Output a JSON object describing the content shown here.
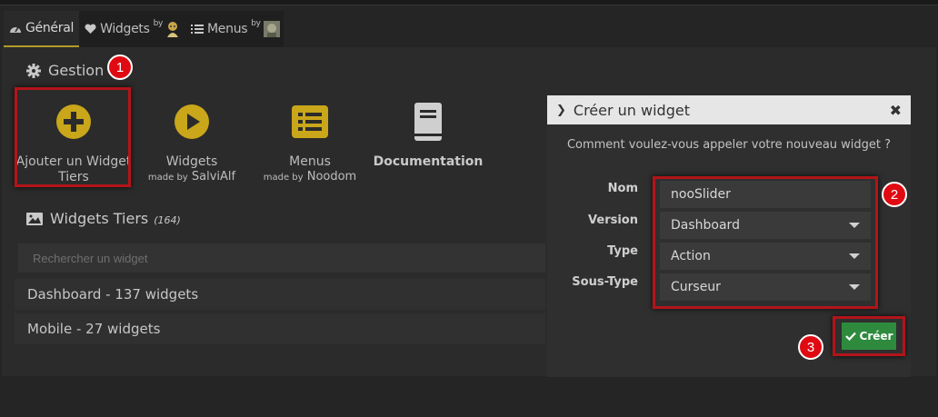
{
  "tabs": [
    {
      "label": "Général",
      "icon": "dashboard-icon",
      "active": true
    },
    {
      "label": "Widgets",
      "icon": "heart-icon",
      "sup": "by"
    },
    {
      "label": "Menus",
      "icon": "list-icon",
      "sup": "by"
    }
  ],
  "gestion": {
    "title": "Gestion",
    "cards": [
      {
        "label_line1": "Ajouter un Widget",
        "label_line2": "Tiers",
        "icon": "plus-circle-icon"
      },
      {
        "label": "Widgets",
        "sub_prefix": "made by",
        "sub_name": "SalviAlf",
        "icon": "play-circle-icon"
      },
      {
        "label": "Menus",
        "sub_prefix": "made by",
        "sub_name": "Noodom",
        "icon": "list-icon"
      },
      {
        "label": "Documentation",
        "icon": "book-icon"
      }
    ]
  },
  "widgets_tiers": {
    "title": "Widgets Tiers",
    "count": "(164)",
    "search_placeholder": "Rechercher un widget",
    "groups": [
      "Dashboard - 137 widgets",
      "Mobile - 27 widgets"
    ]
  },
  "modal": {
    "title": "Créer un widget",
    "question": "Comment voulez-vous appeler votre nouveau widget ?",
    "fields": [
      {
        "label": "Nom",
        "value": "nooSlider"
      },
      {
        "label": "Version",
        "value": "Dashboard"
      },
      {
        "label": "Type",
        "value": "Action"
      },
      {
        "label": "Sous-Type",
        "value": "Curseur"
      }
    ],
    "create_label": "Créer"
  },
  "badges": [
    "1",
    "2",
    "3"
  ],
  "colors": {
    "accent_yellow": "#c9a61a",
    "highlight_red": "#b3141a",
    "badge_red": "#e00b12",
    "create_green": "#2e8b3e"
  }
}
